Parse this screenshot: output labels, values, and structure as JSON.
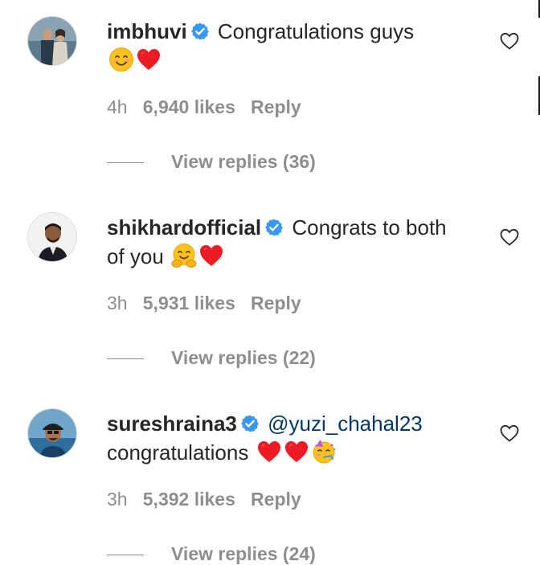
{
  "comments": [
    {
      "username": "imbhuvi",
      "text": "Congratulations guys",
      "emojis": [
        "smiling-face-icon",
        "red-heart-icon"
      ],
      "time": "4h",
      "likes": "6,940 likes",
      "reply_label": "Reply",
      "view_replies": "View replies (36)"
    },
    {
      "username": "shikhardofficial",
      "text": "Congrats to both of you",
      "emojis": [
        "hugging-face-icon",
        "red-heart-icon"
      ],
      "time": "3h",
      "likes": "5,931 likes",
      "reply_label": "Reply",
      "view_replies": "View replies (22)"
    },
    {
      "username": "sureshraina3",
      "mention": "@yuzi_chahal23",
      "text": "congratulations",
      "emojis": [
        "red-heart-icon",
        "red-heart-icon",
        "partying-face-icon"
      ],
      "time": "3h",
      "likes": "5,392 likes",
      "reply_label": "Reply",
      "view_replies": "View replies (24)"
    }
  ],
  "colors": {
    "verified": "#3897f0",
    "mention": "#00376b",
    "meta": "#8e8e8e",
    "heart": "#ed1c24"
  }
}
